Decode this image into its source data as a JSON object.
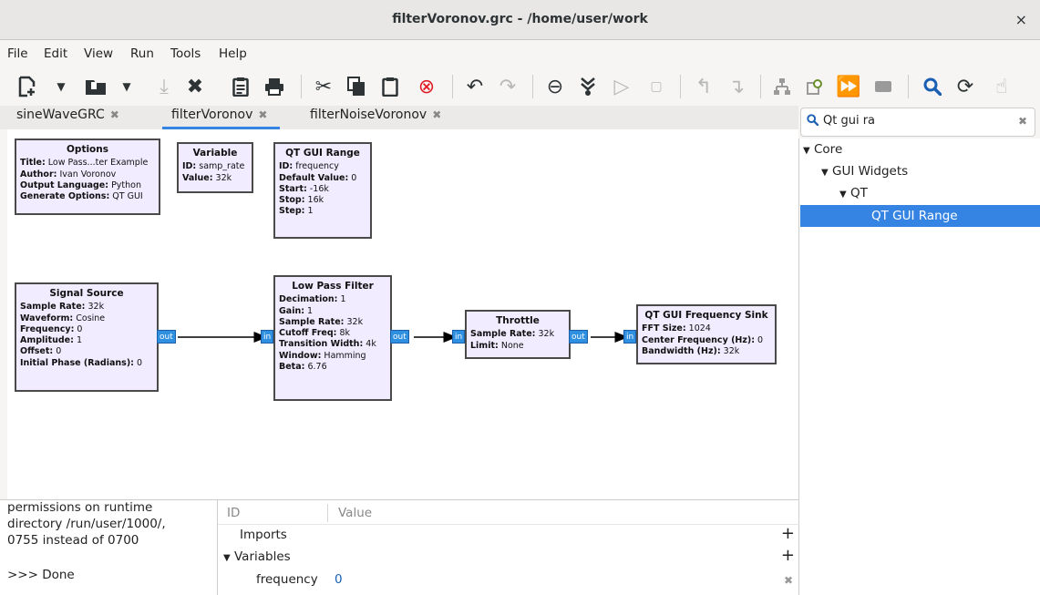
{
  "window": {
    "title": "filterVoronov.grc - /home/user/work",
    "close_glyph": "×"
  },
  "menu": [
    "File",
    "Edit",
    "View",
    "Run",
    "Tools",
    "Help"
  ],
  "toolbar": {
    "icons": [
      "new-icon",
      "dropdown-arrow-icon",
      "open-icon",
      "dropdown-arrow-icon",
      "save-icon",
      "close-file-icon",
      "report-icon",
      "print-icon",
      "cut-icon",
      "copy-icon",
      "paste-icon",
      "delete-icon",
      "undo-icon",
      "redo-icon",
      "disable-icon",
      "bypass-icon",
      "execute-icon",
      "stop-icon",
      "rotate-ccw-icon",
      "rotate-cw-icon",
      "generate-icon",
      "find-block-icon",
      "run-icon",
      "kill-icon",
      "search-icon",
      "reload-icon",
      "help-icon"
    ]
  },
  "tabs": [
    {
      "label": "sineWaveGRC",
      "close": "✖"
    },
    {
      "label": "filterVoronov",
      "close": "✖"
    },
    {
      "label": "filterNoiseVoronov",
      "close": "✖"
    }
  ],
  "blocks": {
    "options": {
      "title": "Options",
      "params": [
        {
          "k": "Title:",
          "v": " Low Pass...ter Example"
        },
        {
          "k": "Author:",
          "v": " Ivan Voronov"
        },
        {
          "k": "Output Language:",
          "v": " Python"
        },
        {
          "k": "Generate Options:",
          "v": " QT GUI"
        }
      ]
    },
    "variable": {
      "title": "Variable",
      "params": [
        {
          "k": "ID:",
          "v": " samp_rate"
        },
        {
          "k": "Value:",
          "v": " 32k"
        }
      ]
    },
    "qtrange": {
      "title": "QT GUI Range",
      "params": [
        {
          "k": "ID:",
          "v": " frequency"
        },
        {
          "k": "Default Value:",
          "v": " 0"
        },
        {
          "k": "Start:",
          "v": " -16k"
        },
        {
          "k": "Stop:",
          "v": " 16k"
        },
        {
          "k": "Step:",
          "v": " 1"
        }
      ]
    },
    "sigsrc": {
      "title": "Signal Source",
      "params": [
        {
          "k": "Sample Rate:",
          "v": " 32k"
        },
        {
          "k": "Waveform:",
          "v": " Cosine"
        },
        {
          "k": "Frequency:",
          "v": " 0"
        },
        {
          "k": "Amplitude:",
          "v": " 1"
        },
        {
          "k": "Offset:",
          "v": " 0"
        },
        {
          "k": "Initial Phase (Radians):",
          "v": " 0"
        }
      ]
    },
    "lpf": {
      "title": "Low Pass Filter",
      "params": [
        {
          "k": "Decimation:",
          "v": " 1"
        },
        {
          "k": "Gain:",
          "v": " 1"
        },
        {
          "k": "Sample Rate:",
          "v": " 32k"
        },
        {
          "k": "Cutoff Freq:",
          "v": " 8k"
        },
        {
          "k": "Transition Width:",
          "v": " 4k"
        },
        {
          "k": "Window:",
          "v": " Hamming"
        },
        {
          "k": "Beta:",
          "v": " 6.76"
        }
      ]
    },
    "throttle": {
      "title": "Throttle",
      "params": [
        {
          "k": "Sample Rate:",
          "v": " 32k"
        },
        {
          "k": "Limit:",
          "v": " None"
        }
      ]
    },
    "freqsink": {
      "title": "QT GUI Frequency Sink",
      "params": [
        {
          "k": "FFT Size:",
          "v": " 1024"
        },
        {
          "k": "Center Frequency (Hz):",
          "v": " 0"
        },
        {
          "k": "Bandwidth (Hz):",
          "v": " 32k"
        }
      ]
    }
  },
  "ports": {
    "out": "out",
    "in": "in"
  },
  "search": {
    "value": "Qt gui ra",
    "clear": "✖"
  },
  "tree": {
    "core": "Core",
    "gui_widgets": "GUI Widgets",
    "qt": "QT",
    "qt_gui_range": "QT GUI Range",
    "expander": "▼"
  },
  "console": [
    "permissions on runtime",
    "directory /run/user/1000/,",
    "0755 instead of 0700",
    ">>> Done"
  ],
  "vars": {
    "col_id": "ID",
    "col_value": "Value",
    "imports": "Imports",
    "variables": "Variables",
    "expander": "▼",
    "row_id": "frequency",
    "row_value": "0",
    "plus": "+",
    "remove": "✖"
  },
  "colors": {
    "accent": "#3584e4",
    "block_bg": "#f1ecff",
    "port": "#2f8fe0"
  }
}
